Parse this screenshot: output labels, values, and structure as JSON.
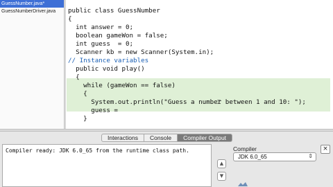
{
  "files": {
    "items": [
      {
        "label": "GuessNumber.java*",
        "selected": true
      },
      {
        "label": "GuessNumberDriver.java",
        "selected": false
      }
    ]
  },
  "editor": {
    "lines": [
      "public class GuessNumber",
      "{",
      "  int answer = 0;",
      "  boolean gameWon = false;",
      "  int guess  = 0;",
      "  Scanner kb = new Scanner(System.in);",
      "// Instance variables",
      "  public void play()",
      "  {",
      "    while (gameWon == false)",
      "    {",
      "      System.out.println(\"Guess a number between 1 and 10: \");",
      "      guess = ",
      "    }"
    ],
    "highlight_color": "#dff0d6"
  },
  "bottom": {
    "tabs": [
      {
        "label": "Interactions",
        "active": false
      },
      {
        "label": "Console",
        "active": false
      },
      {
        "label": "Compiler Output",
        "active": true
      }
    ],
    "output_text": "Compiler ready: JDK 6.0_65 from the runtime class path.",
    "compiler_label": "Compiler",
    "compiler_selected": "JDK 6.0_65",
    "close_label": "×"
  },
  "icons": {
    "scroll_up": "chevron-up-icon",
    "scroll_down": "chevron-down-icon",
    "close": "close-icon",
    "dropdown": "dropdown-arrows-icon"
  },
  "colors": {
    "selection": "#3d6fd6",
    "active_tab": "#7a7a7a"
  }
}
